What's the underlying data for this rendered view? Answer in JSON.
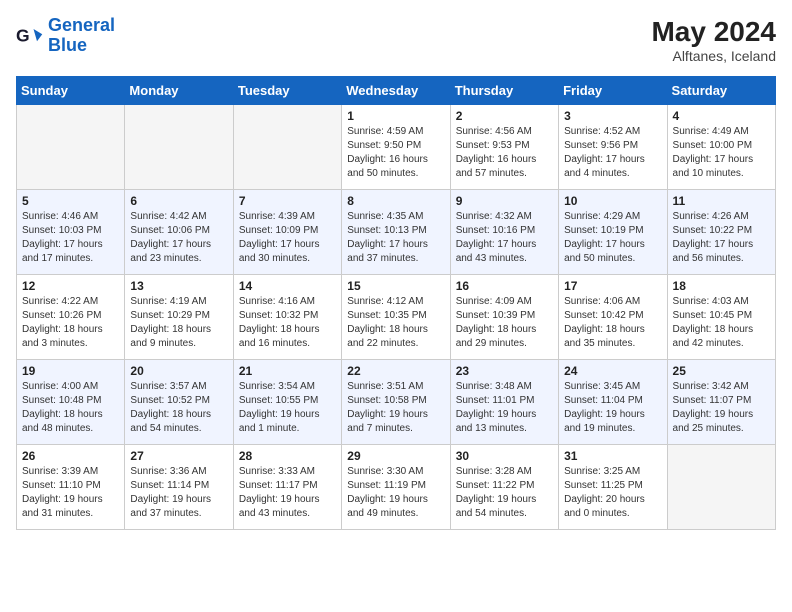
{
  "header": {
    "logo_general": "General",
    "logo_blue": "Blue",
    "month_year": "May 2024",
    "location": "Alftanes, Iceland"
  },
  "weekdays": [
    "Sunday",
    "Monday",
    "Tuesday",
    "Wednesday",
    "Thursday",
    "Friday",
    "Saturday"
  ],
  "weeks": [
    [
      {
        "day": "",
        "info": ""
      },
      {
        "day": "",
        "info": ""
      },
      {
        "day": "",
        "info": ""
      },
      {
        "day": "1",
        "info": "Sunrise: 4:59 AM\nSunset: 9:50 PM\nDaylight: 16 hours\nand 50 minutes."
      },
      {
        "day": "2",
        "info": "Sunrise: 4:56 AM\nSunset: 9:53 PM\nDaylight: 16 hours\nand 57 minutes."
      },
      {
        "day": "3",
        "info": "Sunrise: 4:52 AM\nSunset: 9:56 PM\nDaylight: 17 hours\nand 4 minutes."
      },
      {
        "day": "4",
        "info": "Sunrise: 4:49 AM\nSunset: 10:00 PM\nDaylight: 17 hours\nand 10 minutes."
      }
    ],
    [
      {
        "day": "5",
        "info": "Sunrise: 4:46 AM\nSunset: 10:03 PM\nDaylight: 17 hours\nand 17 minutes."
      },
      {
        "day": "6",
        "info": "Sunrise: 4:42 AM\nSunset: 10:06 PM\nDaylight: 17 hours\nand 23 minutes."
      },
      {
        "day": "7",
        "info": "Sunrise: 4:39 AM\nSunset: 10:09 PM\nDaylight: 17 hours\nand 30 minutes."
      },
      {
        "day": "8",
        "info": "Sunrise: 4:35 AM\nSunset: 10:13 PM\nDaylight: 17 hours\nand 37 minutes."
      },
      {
        "day": "9",
        "info": "Sunrise: 4:32 AM\nSunset: 10:16 PM\nDaylight: 17 hours\nand 43 minutes."
      },
      {
        "day": "10",
        "info": "Sunrise: 4:29 AM\nSunset: 10:19 PM\nDaylight: 17 hours\nand 50 minutes."
      },
      {
        "day": "11",
        "info": "Sunrise: 4:26 AM\nSunset: 10:22 PM\nDaylight: 17 hours\nand 56 minutes."
      }
    ],
    [
      {
        "day": "12",
        "info": "Sunrise: 4:22 AM\nSunset: 10:26 PM\nDaylight: 18 hours\nand 3 minutes."
      },
      {
        "day": "13",
        "info": "Sunrise: 4:19 AM\nSunset: 10:29 PM\nDaylight: 18 hours\nand 9 minutes."
      },
      {
        "day": "14",
        "info": "Sunrise: 4:16 AM\nSunset: 10:32 PM\nDaylight: 18 hours\nand 16 minutes."
      },
      {
        "day": "15",
        "info": "Sunrise: 4:12 AM\nSunset: 10:35 PM\nDaylight: 18 hours\nand 22 minutes."
      },
      {
        "day": "16",
        "info": "Sunrise: 4:09 AM\nSunset: 10:39 PM\nDaylight: 18 hours\nand 29 minutes."
      },
      {
        "day": "17",
        "info": "Sunrise: 4:06 AM\nSunset: 10:42 PM\nDaylight: 18 hours\nand 35 minutes."
      },
      {
        "day": "18",
        "info": "Sunrise: 4:03 AM\nSunset: 10:45 PM\nDaylight: 18 hours\nand 42 minutes."
      }
    ],
    [
      {
        "day": "19",
        "info": "Sunrise: 4:00 AM\nSunset: 10:48 PM\nDaylight: 18 hours\nand 48 minutes."
      },
      {
        "day": "20",
        "info": "Sunrise: 3:57 AM\nSunset: 10:52 PM\nDaylight: 18 hours\nand 54 minutes."
      },
      {
        "day": "21",
        "info": "Sunrise: 3:54 AM\nSunset: 10:55 PM\nDaylight: 19 hours\nand 1 minute."
      },
      {
        "day": "22",
        "info": "Sunrise: 3:51 AM\nSunset: 10:58 PM\nDaylight: 19 hours\nand 7 minutes."
      },
      {
        "day": "23",
        "info": "Sunrise: 3:48 AM\nSunset: 11:01 PM\nDaylight: 19 hours\nand 13 minutes."
      },
      {
        "day": "24",
        "info": "Sunrise: 3:45 AM\nSunset: 11:04 PM\nDaylight: 19 hours\nand 19 minutes."
      },
      {
        "day": "25",
        "info": "Sunrise: 3:42 AM\nSunset: 11:07 PM\nDaylight: 19 hours\nand 25 minutes."
      }
    ],
    [
      {
        "day": "26",
        "info": "Sunrise: 3:39 AM\nSunset: 11:10 PM\nDaylight: 19 hours\nand 31 minutes."
      },
      {
        "day": "27",
        "info": "Sunrise: 3:36 AM\nSunset: 11:14 PM\nDaylight: 19 hours\nand 37 minutes."
      },
      {
        "day": "28",
        "info": "Sunrise: 3:33 AM\nSunset: 11:17 PM\nDaylight: 19 hours\nand 43 minutes."
      },
      {
        "day": "29",
        "info": "Sunrise: 3:30 AM\nSunset: 11:19 PM\nDaylight: 19 hours\nand 49 minutes."
      },
      {
        "day": "30",
        "info": "Sunrise: 3:28 AM\nSunset: 11:22 PM\nDaylight: 19 hours\nand 54 minutes."
      },
      {
        "day": "31",
        "info": "Sunrise: 3:25 AM\nSunset: 11:25 PM\nDaylight: 20 hours\nand 0 minutes."
      },
      {
        "day": "",
        "info": ""
      }
    ]
  ]
}
